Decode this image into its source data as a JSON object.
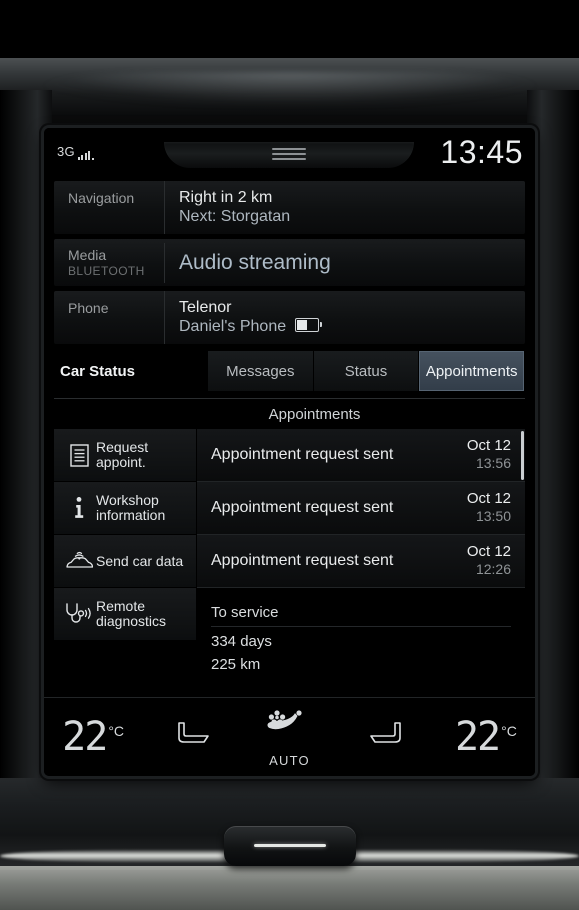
{
  "statusbar": {
    "network": "3G",
    "signal_icon": "signal-bars-icon",
    "time": "13:45"
  },
  "tiles": [
    {
      "name": "navigation",
      "label": "Navigation",
      "sublabel": "",
      "line1": "Right in 2 km",
      "line2": "Next: Storgatan"
    },
    {
      "name": "media",
      "label": "Media",
      "sublabel": "BLUETOOTH",
      "line1": "Audio streaming",
      "line2": ""
    },
    {
      "name": "phone",
      "label": "Phone",
      "sublabel": "",
      "line1": "Telenor",
      "line2": "Daniel's Phone",
      "battery_icon": "battery-half-icon"
    }
  ],
  "carstatus": {
    "title": "Car Status",
    "tabs": [
      {
        "label": "Messages",
        "selected": false
      },
      {
        "label": "Status",
        "selected": false
      },
      {
        "label": "Appointments",
        "selected": true
      }
    ],
    "section_title": "Appointments"
  },
  "menu": [
    {
      "label": "Request appoint.",
      "icon": "document-icon"
    },
    {
      "label": "Workshop information",
      "icon": "info-icon"
    },
    {
      "label": "Send car data",
      "icon": "car-upload-icon"
    },
    {
      "label": "Remote diagnostics",
      "icon": "stethoscope-icon"
    }
  ],
  "appointments": [
    {
      "text": "Appointment request sent",
      "date": "Oct 12",
      "time": "13:56"
    },
    {
      "text": "Appointment request sent",
      "date": "Oct 12",
      "time": "13:50"
    },
    {
      "text": "Appointment request sent",
      "date": "Oct 12",
      "time": "12:26"
    }
  ],
  "service": {
    "header": "To service",
    "days": "334 days",
    "distance": "225 km"
  },
  "climate": {
    "temp_left": "22",
    "temp_right": "22",
    "unit": "°C",
    "auto_label": "AUTO",
    "seat_left_icon": "seat-icon",
    "seat_right_icon": "seat-icon",
    "airflow_icon": "airflow-auto-icon"
  },
  "colors": {
    "accent_tab": "#46525f",
    "media_text": "#aebcc8",
    "screen_bg": "#000000"
  }
}
